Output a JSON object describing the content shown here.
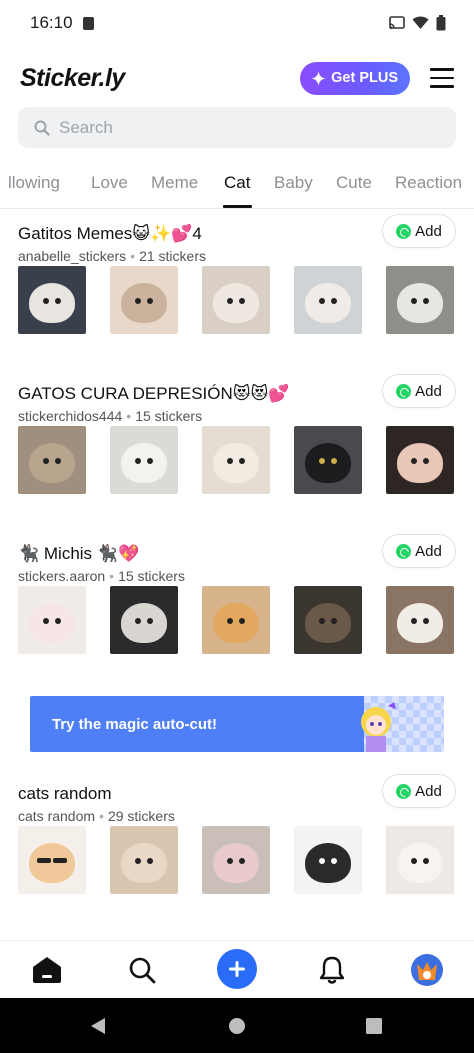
{
  "status_bar": {
    "time": "16:10"
  },
  "header": {
    "logo": "Sticker.ly",
    "plus_label": "Get PLUS"
  },
  "search": {
    "placeholder": "Search"
  },
  "tabs": [
    {
      "label": "llowing"
    },
    {
      "label": "Love"
    },
    {
      "label": "Meme"
    },
    {
      "label": "Cat"
    },
    {
      "label": "Baby"
    },
    {
      "label": "Cute"
    },
    {
      "label": "Reaction"
    }
  ],
  "active_tab": "Cat",
  "add_label": "Add",
  "packs": [
    {
      "title": "Gatitos Memes😺✨💕4",
      "author": "anabelle_stickers",
      "count": "21 stickers"
    },
    {
      "title": "GATOS CURA DEPRESIÓN😻😻💕",
      "author": "stickerchidos444",
      "count": "15 stickers"
    },
    {
      "title": "🐈‍⬛ Michis 🐈‍⬛💖",
      "author": "stickers.aaron",
      "count": "15 stickers"
    },
    {
      "title": "cats random",
      "author": "cats random",
      "count": "29 stickers"
    }
  ],
  "banner": {
    "text": "Try the magic auto-cut!"
  },
  "colors": {
    "accent": "#2a6cf7",
    "plus_gradient_start": "#8a4dff",
    "banner": "#4f7ff6",
    "whatsapp": "#25d366"
  }
}
